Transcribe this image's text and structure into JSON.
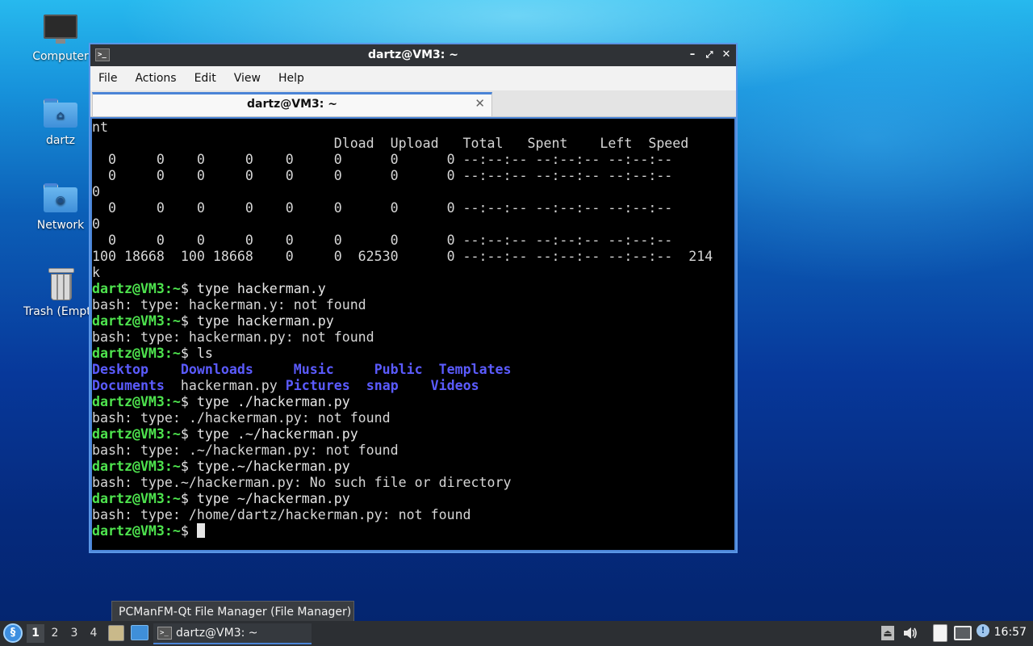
{
  "desktop": {
    "icons": [
      {
        "label": "Computer"
      },
      {
        "label": "dartz"
      },
      {
        "label": "Network"
      },
      {
        "label": "Trash (Empt"
      }
    ]
  },
  "window": {
    "title": "dartz@VM3: ~",
    "buttons": {
      "minimize": "–",
      "maximize": "⤢",
      "close": "✕"
    },
    "menu": [
      "File",
      "Actions",
      "Edit",
      "View",
      "Help"
    ],
    "tab": {
      "label": "dartz@VM3: ~",
      "close": "✕"
    }
  },
  "terminal": {
    "prompt_user": "dartz@VM3",
    "prompt_path": ":~",
    "prompt_sym": "$ ",
    "lines": [
      {
        "t": "nt"
      },
      {
        "t": "                              Dload  Upload   Total   Spent    Left  Speed"
      },
      {
        "t": "  0     0    0     0    0     0      0      0 --:--:-- --:--:-- --:--:--"
      },
      {
        "t": "  0     0    0     0    0     0      0      0 --:--:-- --:--:-- --:--:--"
      },
      {
        "t": "0"
      },
      {
        "t": "  0     0    0     0    0     0      0      0 --:--:-- --:--:-- --:--:--"
      },
      {
        "t": "0"
      },
      {
        "t": "  0     0    0     0    0     0      0      0 --:--:-- --:--:-- --:--:--"
      },
      {
        "t": "100 18668  100 18668    0     0  62530      0 --:--:-- --:--:-- --:--:--  214"
      },
      {
        "t": "k"
      },
      {
        "cmd": "type hackerman.y"
      },
      {
        "t": "bash: type: hackerman.y: not found"
      },
      {
        "cmd": "type hackerman.py"
      },
      {
        "t": "bash: type: hackerman.py: not found"
      },
      {
        "cmd": "ls"
      },
      {
        "ls": [
          [
            "Desktop",
            "dir"
          ],
          [
            "    ",
            ""
          ],
          [
            "Downloads",
            "dir"
          ],
          [
            "     ",
            ""
          ],
          [
            "Music",
            "dir"
          ],
          [
            "     ",
            ""
          ],
          [
            "Public",
            "dir"
          ],
          [
            "  ",
            ""
          ],
          [
            "Templates",
            "dir"
          ]
        ]
      },
      {
        "ls": [
          [
            "Documents",
            "dir"
          ],
          [
            "  ",
            ""
          ],
          [
            "hackerman.py",
            "file"
          ],
          [
            " ",
            ""
          ],
          [
            "Pictures",
            "dir"
          ],
          [
            "  ",
            ""
          ],
          [
            "snap",
            "dir"
          ],
          [
            "    ",
            ""
          ],
          [
            "Videos",
            "dir"
          ]
        ]
      },
      {
        "cmd": "type ./hackerman.py"
      },
      {
        "t": "bash: type: ./hackerman.py: not found"
      },
      {
        "cmd": "type .~/hackerman.py"
      },
      {
        "t": "bash: type: .~/hackerman.py: not found"
      },
      {
        "cmd": "type.~/hackerman.py"
      },
      {
        "t": "bash: type.~/hackerman.py: No such file or directory"
      },
      {
        "cmd": "type ~/hackerman.py"
      },
      {
        "t": "bash: type: /home/dartz/hackerman.py: not found"
      },
      {
        "cmd": "",
        "cursor": true
      }
    ]
  },
  "tooltip": "PCManFM-Qt File Manager (File Manager)",
  "taskbar": {
    "start_icon": "lxqt-start-icon",
    "workspaces": [
      "1",
      "2",
      "3",
      "4"
    ],
    "active_workspace": "1",
    "task_label": "dartz@VM3: ~",
    "tray": {
      "eject": "⏏",
      "volume": "🔊",
      "clipboard": "📋",
      "network": "🖧",
      "updates": "!"
    },
    "clock": "16:57"
  },
  "colors": {
    "accent": "#4a84d6",
    "prompt": "#4ee44e",
    "directory": "#5b5bff"
  }
}
